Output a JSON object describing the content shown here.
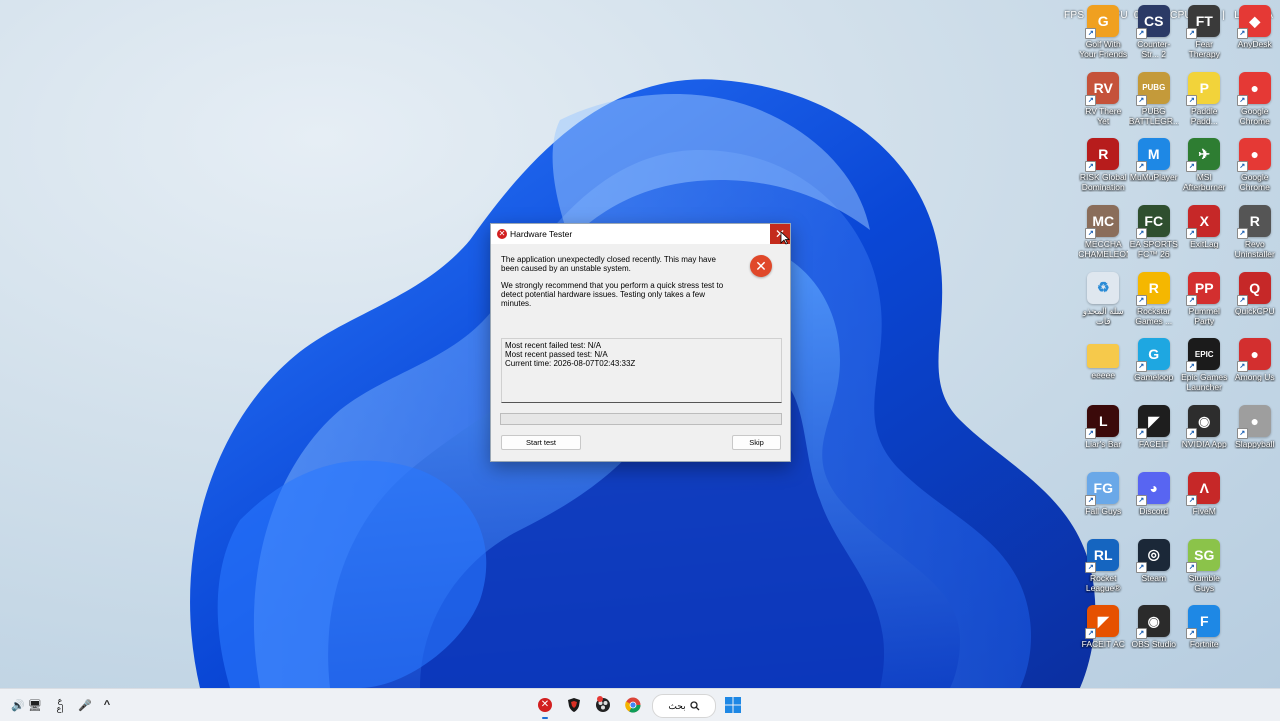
{
  "overlay": {
    "fps": "FPS",
    "gpu": "GPU",
    "cpu": "CPU",
    "lat": "LAT",
    "sep": "|",
    "v1": "0",
    "v2": "0%",
    "v3": "0%",
    "v4": "NA"
  },
  "desktop_icons": [
    {
      "label": "Golf With Your Friends",
      "glyph": "G",
      "color": "#f0a020",
      "icon": "golf-icon"
    },
    {
      "label": "Counter-Str... 2",
      "glyph": "CS",
      "color": "#2b3a66",
      "icon": "counter-strike-icon"
    },
    {
      "label": "Fear Therapy",
      "glyph": "FT",
      "color": "#3a3a3a",
      "icon": "fear-therapy-icon"
    },
    {
      "label": "AnyDesk",
      "glyph": "◆",
      "color": "#e53935",
      "icon": "anydesk-icon"
    },
    {
      "label": "RV There Yet",
      "glyph": "RV",
      "color": "#c5523a",
      "icon": "rv-there-yet-icon"
    },
    {
      "label": "PUBG BATTLEGR...",
      "glyph": "PUBG",
      "color": "#c49a3a",
      "icon": "pubg-icon"
    },
    {
      "label": "Paddle Padd...",
      "glyph": "P",
      "color": "#f2d33a",
      "icon": "paddle-icon"
    },
    {
      "label": "Google Chrome",
      "glyph": "●",
      "color": "#e53935",
      "icon": "chrome-icon"
    },
    {
      "label": "RISK Global Domination",
      "glyph": "R",
      "color": "#b71c1c",
      "icon": "risk-icon"
    },
    {
      "label": "MuMuPlayer",
      "glyph": "M",
      "color": "#1e88e5",
      "icon": "mumuplayer-icon"
    },
    {
      "label": "MSI Afterburner",
      "glyph": "✈",
      "color": "#2e7d32",
      "icon": "msi-afterburner-icon"
    },
    {
      "label": "Google Chrome",
      "glyph": "●",
      "color": "#e53935",
      "icon": "chrome-icon"
    },
    {
      "label": "MECCHA CHAMELEON",
      "glyph": "MC",
      "color": "#8a6d5a",
      "icon": "meccha-chameleon-icon"
    },
    {
      "label": "EA SPORTS FC™ 26",
      "glyph": "FC",
      "color": "#2f4f2f",
      "icon": "ea-sports-fc-icon"
    },
    {
      "label": "ExitLag",
      "glyph": "X",
      "color": "#c62828",
      "icon": "exitlag-icon"
    },
    {
      "label": "Revo Uninstaller",
      "glyph": "R",
      "color": "#555555",
      "icon": "revo-uninstaller-icon"
    },
    {
      "label": "سلة المحذو فات",
      "glyph": "♻",
      "color": "#dfe7ef",
      "icon": "recycle-bin-icon"
    },
    {
      "label": "Rockstar Games ...",
      "glyph": "R",
      "color": "#f5b700",
      "icon": "rockstar-icon"
    },
    {
      "label": "Pummel Party",
      "glyph": "PP",
      "color": "#d32f2f",
      "icon": "pummel-party-icon"
    },
    {
      "label": "QuickCPU",
      "glyph": "Q",
      "color": "#c62828",
      "icon": "quickcpu-icon"
    },
    {
      "label": "eeeee",
      "glyph": "",
      "color": "#f6c94b",
      "icon": "folder-icon"
    },
    {
      "label": "Gameloop",
      "glyph": "G",
      "color": "#1ea7e1",
      "icon": "gameloop-icon"
    },
    {
      "label": "Epic Games Launcher",
      "glyph": "EPIC",
      "color": "#1b1b1b",
      "icon": "epic-games-icon"
    },
    {
      "label": "Among Us",
      "glyph": "●",
      "color": "#d32f2f",
      "icon": "among-us-icon"
    },
    {
      "label": "Liar's Bar",
      "glyph": "L",
      "color": "#3b0a0a",
      "icon": "liars-bar-icon"
    },
    {
      "label": "FACEIT",
      "glyph": "◤",
      "color": "#1e1e1e",
      "icon": "faceit-icon"
    },
    {
      "label": "NVIDIA App",
      "glyph": "◉",
      "color": "#2d2d2d",
      "icon": "nvidia-icon"
    },
    {
      "label": "Slappyball",
      "glyph": "●",
      "color": "#9e9e9e",
      "icon": "slappyball-icon"
    },
    {
      "label": "Fall Guys",
      "glyph": "FG",
      "color": "#6aa8e8",
      "icon": "fall-guys-icon"
    },
    {
      "label": "Discord",
      "glyph": "◕",
      "color": "#5865f2",
      "icon": "discord-icon"
    },
    {
      "label": "FiveM",
      "glyph": "Λ",
      "color": "#c62828",
      "icon": "fivem-icon"
    },
    {
      "label": "",
      "glyph": "",
      "color": "transparent",
      "icon": "empty-slot"
    },
    {
      "label": "Rocket League®",
      "glyph": "RL",
      "color": "#1565c0",
      "icon": "rocket-league-icon"
    },
    {
      "label": "Steam",
      "glyph": "◎",
      "color": "#1b2838",
      "icon": "steam-icon"
    },
    {
      "label": "Stumble Guys",
      "glyph": "SG",
      "color": "#8bc34a",
      "icon": "stumble-guys-icon"
    },
    {
      "label": "",
      "glyph": "",
      "color": "transparent",
      "icon": "empty-slot"
    },
    {
      "label": "FACEIT AC",
      "glyph": "◤",
      "color": "#e65100",
      "icon": "faceit-ac-icon"
    },
    {
      "label": "OBS Studio",
      "glyph": "◉",
      "color": "#2b2b2b",
      "icon": "obs-icon"
    },
    {
      "label": "Fortnite",
      "glyph": "F",
      "color": "#1e88e5",
      "icon": "fortnite-icon"
    }
  ],
  "dialog": {
    "title": "Hardware Tester",
    "close_glyph": "✕",
    "message1": "The application unexpectedly closed recently. This may have been caused by an unstable system.",
    "message2": "We strongly recommend that you perform a quick stress test to detect potential hardware issues. Testing only takes a few minutes.",
    "error_glyph": "✕",
    "info": {
      "failed": "Most recent failed test: N/A",
      "passed": "Most recent passed test: N/A",
      "time": "Current time: 2026-08-07T02:43:33Z"
    },
    "progress": 0,
    "start_label": "Start test",
    "skip_label": "Skip"
  },
  "taskbar": {
    "search_text": "بحث",
    "tray": {
      "volume": "🔊",
      "network": "🖥",
      "lang_top": "ع",
      "lang_bottom": "ع|",
      "mic": "🎤",
      "chevron": "^"
    }
  }
}
